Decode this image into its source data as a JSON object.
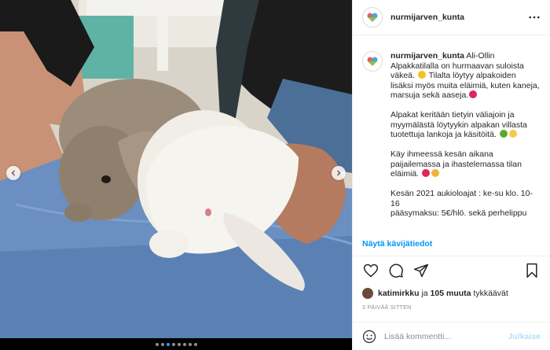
{
  "header": {
    "username": "nurmijarven_kunta",
    "more_icon": "more-horizontal-icon"
  },
  "caption": {
    "username": "nurmijarven_kunta",
    "paragraphs": [
      "Ali-Ollin Alpakkatilalla on hurmaavan suloista väkeä.",
      "Tilalta löytyy alpakoiden lisäksi myös muita eläimiä, kuten kaneja, marsuja sekä aaseja.",
      "Alpakat keritään tietyin väliajoin ja myymälästä löytyykin alpakan villasta tuotettuja lankoja ja käsitöitä.",
      "Käy ihmeessä kesän aikana paijailemassa ja ihastelemassa tilan eläimiä.",
      "Kesän 2021 aukioloajat : ke-su klo. 10-16",
      "pääsymaksu: 5€/hlö. sekä perhelippu"
    ]
  },
  "translate_label": "Näytä kävijätiedot",
  "likes": {
    "user": "katimirkku",
    "connector": " ja ",
    "count": "105 muuta",
    "suffix": " tykkäävät"
  },
  "timestamp": "3 PÄIVÄÄ SITTEN",
  "comment": {
    "placeholder": "Lisää kommentti...",
    "post_label": "Julkaise"
  },
  "carousel": {
    "total_slides": 8,
    "active_slide": 3
  },
  "colors": {
    "link": "#0095f6",
    "post_disabled": "#b2dffc",
    "dot_active": "#3897f0"
  }
}
